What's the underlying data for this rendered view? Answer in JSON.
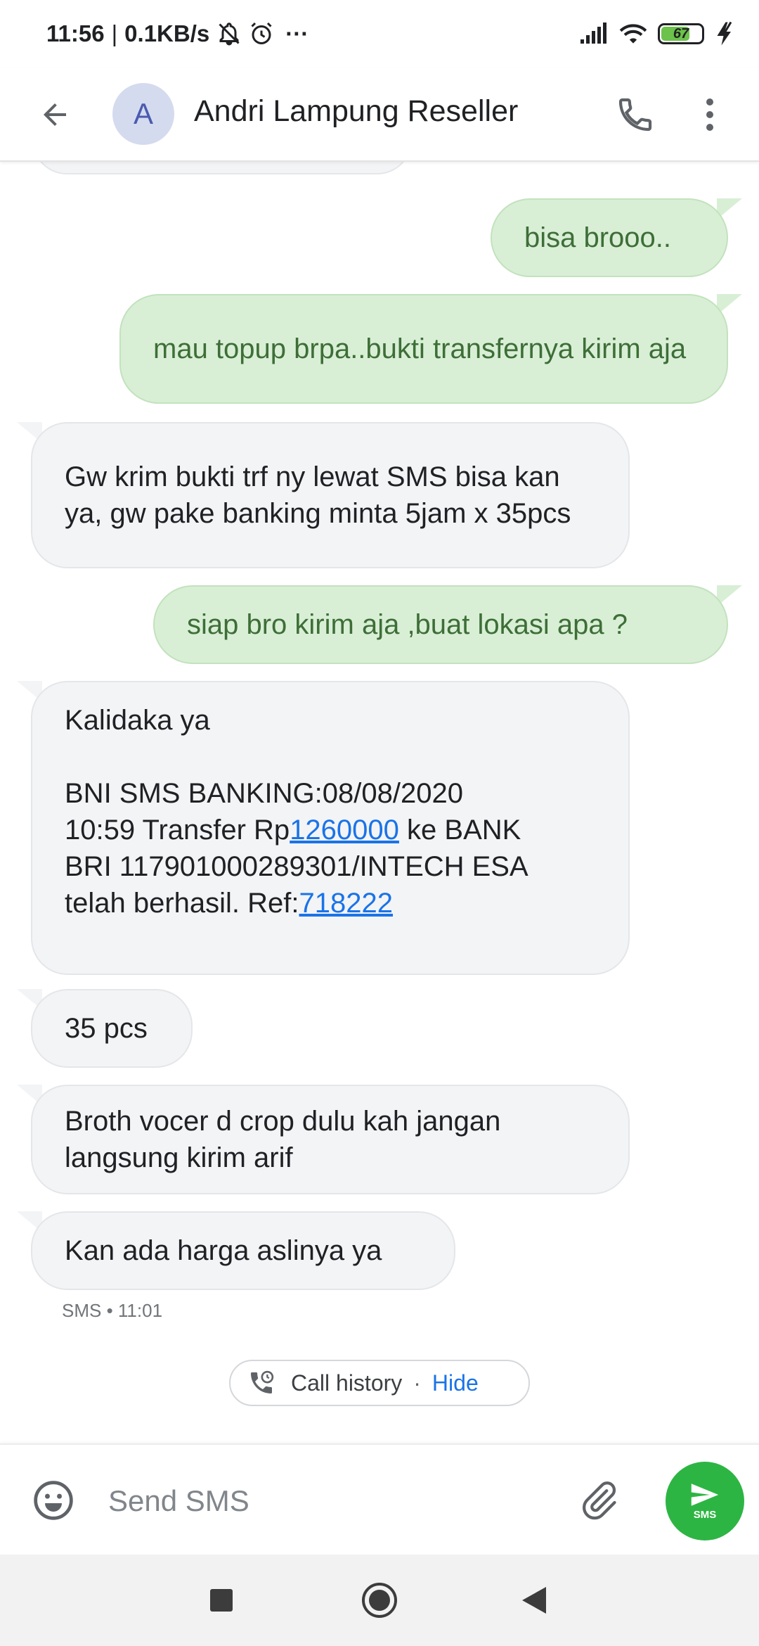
{
  "status_bar": {
    "time": "11:56",
    "separator": "|",
    "network_speed": "0.1KB/s",
    "more": "···",
    "battery_level": "67",
    "icons": [
      "notifications-off-icon",
      "alarm-icon",
      "signal-icon",
      "wifi-icon",
      "battery-icon",
      "charging-icon"
    ]
  },
  "header": {
    "avatar_letter": "A",
    "contact_name": "Andri Lampung Reseller",
    "icons": [
      "back-arrow-icon",
      "phone-icon",
      "more-vert-icon"
    ]
  },
  "messages": [
    {
      "direction": "outgoing",
      "text": "bisa brooo.."
    },
    {
      "direction": "outgoing",
      "text": "mau topup brpa..bukti transfernya kirim aja"
    },
    {
      "direction": "incoming",
      "text": "Gw krim bukti trf ny lewat SMS bisa kan ya, gw pake banking minta 5jam x 35pcs"
    },
    {
      "direction": "outgoing",
      "text": "siap bro kirim aja ,buat lokasi apa ?"
    },
    {
      "direction": "incoming",
      "line1": "Kalidaka ya",
      "line2": "BNI SMS BANKING:08/08/2020",
      "transfer_prefix": "10:59 Transfer Rp",
      "amount_link": "1260000",
      "transfer_suffix": " ke BANK",
      "line4": "BRI 117901000289301/INTECH ESA",
      "ref_prefix": "telah berhasil. Ref:",
      "ref_link": "718222"
    },
    {
      "direction": "incoming",
      "text": "35 pcs"
    },
    {
      "direction": "incoming",
      "text": "Broth vocer d crop dulu kah jangan langsung kirim arif"
    },
    {
      "direction": "incoming",
      "text": "Kan ada harga aslinya ya"
    }
  ],
  "meta": {
    "label": "SMS • 11:01"
  },
  "call_history": {
    "label": "Call history",
    "separator": "·",
    "action": "Hide",
    "icon": "call-history-icon"
  },
  "compose": {
    "placeholder": "Send SMS",
    "send_label": "SMS",
    "icons": [
      "emoji-icon",
      "attach-icon",
      "send-icon"
    ]
  },
  "colors": {
    "accent": "#2db543",
    "link": "#1a73e8",
    "outgoing_bubble": "#d8efd6",
    "incoming_bubble": "#f3f4f6",
    "avatar_bg": "#d4dbee"
  },
  "nav_bar": {
    "icons": [
      "recents-square-icon",
      "home-circle-icon",
      "back-triangle-icon"
    ]
  }
}
